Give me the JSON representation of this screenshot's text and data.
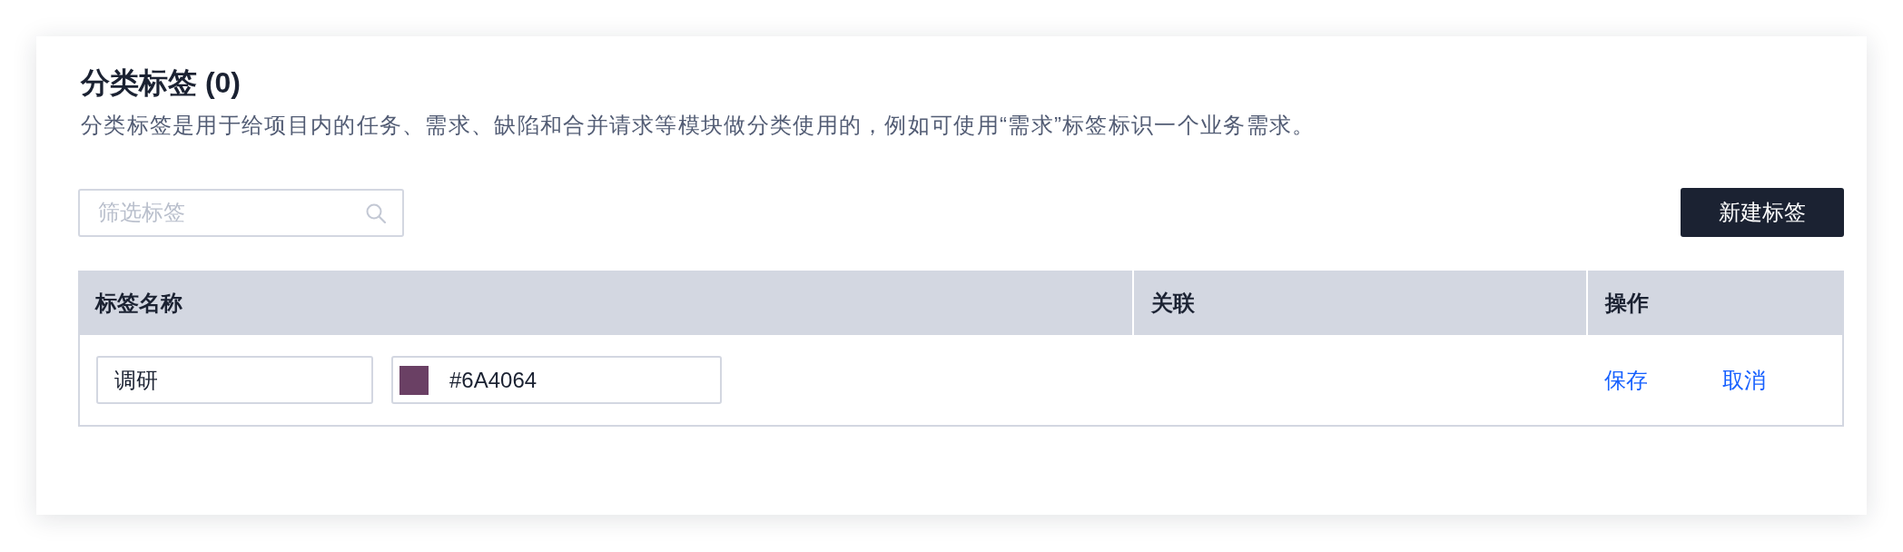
{
  "header": {
    "title": "分类标签 (0)",
    "description": "分类标签是用于给项目内的任务、需求、缺陷和合并请求等模块做分类使用的，例如可使用“需求”标签标识一个业务需求。"
  },
  "toolbar": {
    "search": {
      "placeholder": "筛选标签"
    },
    "new_button": "新建标签"
  },
  "table": {
    "columns": [
      "标签名称",
      "关联",
      "操作"
    ],
    "rows": [
      {
        "name_value": "调研",
        "color": "#6a4064",
        "color_value": "#6A4064",
        "actions": [
          "保存",
          "取消"
        ]
      }
    ]
  }
}
